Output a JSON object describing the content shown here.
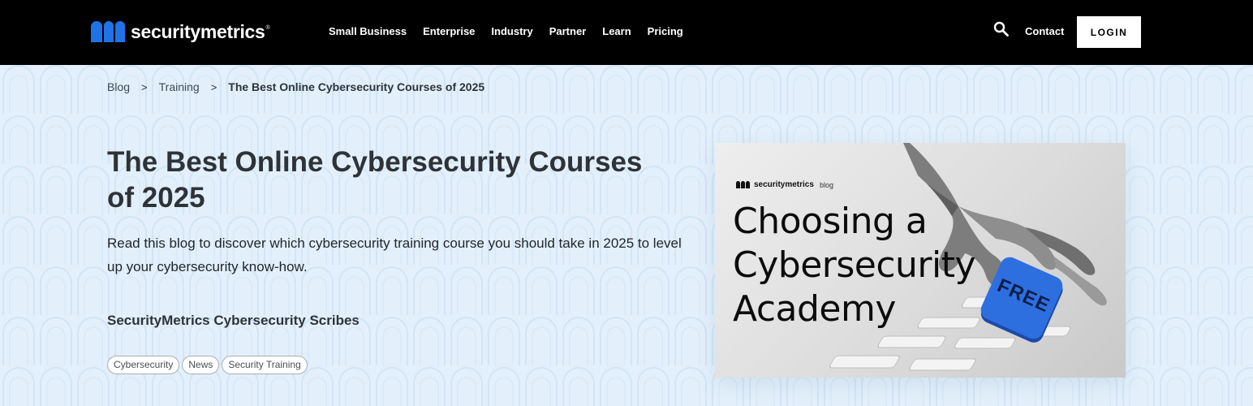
{
  "brand": {
    "name": "securitymetrics",
    "registered": "®",
    "accent": "#1e73e8"
  },
  "nav": {
    "items": [
      "Small Business",
      "Enterprise",
      "Industry",
      "Partner",
      "Learn",
      "Pricing"
    ],
    "search_icon": "search-icon",
    "contact": "Contact",
    "login": "LOGIN"
  },
  "breadcrumb": {
    "items": [
      "Blog",
      "Training"
    ],
    "current": "The Best Online Cybersecurity Courses of 2025",
    "separator": ">"
  },
  "article": {
    "title": "The Best Online Cybersecurity Courses of 2025",
    "description": "Read this blog to discover which cybersecurity training course you should take in 2025 to level up your cybersecurity know-how.",
    "author": "SecurityMetrics Cybersecurity Scribes",
    "tags": [
      "Cybersecurity",
      "News",
      "Security Training"
    ]
  },
  "feature_image": {
    "brand": "securitymetrics",
    "brand_suffix": "blog",
    "headline": "Choosing a Cybersecurity Academy",
    "badge": "FREE",
    "badge_color": "#2e6fe0"
  }
}
